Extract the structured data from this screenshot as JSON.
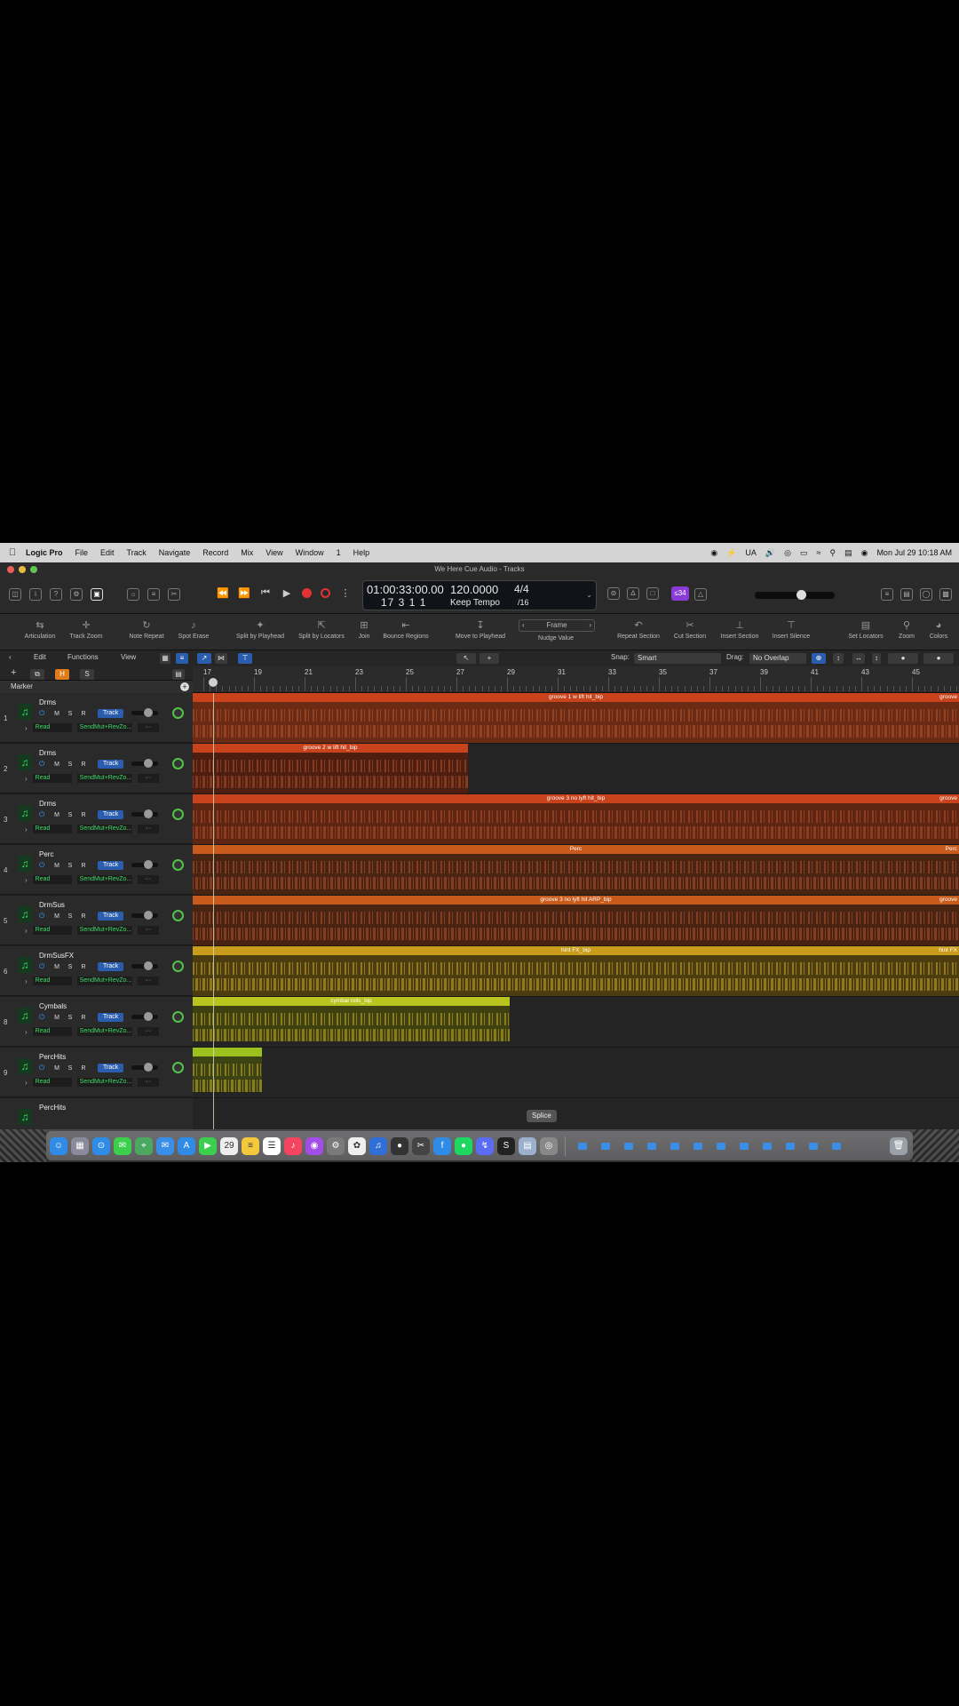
{
  "menubar": {
    "app": "Logic Pro",
    "items": [
      "File",
      "Edit",
      "Track",
      "Navigate",
      "Record",
      "Mix",
      "View",
      "Window",
      "1",
      "Help"
    ],
    "status_icons": [
      "record-status-icon",
      "bolt-icon",
      "UA",
      "volume-icon",
      "focus-icon",
      "battery-icon",
      "wifi-icon",
      "search-icon",
      "control-center-icon",
      "siri-icon"
    ],
    "ua_label": "UA",
    "clock": "Mon Jul 29  10:18 AM"
  },
  "window": {
    "title": "We Here Cue Audio - Tracks"
  },
  "control_bar": {
    "position_time": "01:00:33:00.00",
    "position_bars": "17  3  1     1",
    "tempo": "120.0000",
    "tempo_mode": "Keep Tempo",
    "time_signature": "4/4",
    "division": "/16",
    "cpu_badge": "≤34",
    "master_volume": 0.6
  },
  "toolbar": {
    "tools": [
      {
        "label": "Articulation",
        "icon": "articulation-icon"
      },
      {
        "label": "Track Zoom",
        "icon": "track-zoom-icon"
      },
      {
        "label": "Note Repeat",
        "icon": "note-repeat-icon"
      },
      {
        "label": "Spot Erase",
        "icon": "spot-erase-icon"
      },
      {
        "label": "Split by Playhead",
        "icon": "split-playhead-icon"
      },
      {
        "label": "Split by Locators",
        "icon": "split-locators-icon"
      },
      {
        "label": "Join",
        "icon": "join-icon"
      },
      {
        "label": "Bounce Regions",
        "icon": "bounce-icon"
      },
      {
        "label": "Move to Playhead",
        "icon": "move-playhead-icon"
      },
      {
        "label": "Nudge Value",
        "icon": "nudge-icon"
      },
      {
        "label": "Repeat Section",
        "icon": "repeat-section-icon"
      },
      {
        "label": "Cut Section",
        "icon": "cut-section-icon"
      },
      {
        "label": "Insert Section",
        "icon": "insert-section-icon"
      },
      {
        "label": "Insert Silence",
        "icon": "insert-silence-icon"
      },
      {
        "label": "Set Locators",
        "icon": "set-locators-icon"
      },
      {
        "label": "Zoom",
        "icon": "zoom-icon"
      },
      {
        "label": "Colors",
        "icon": "colors-icon"
      }
    ],
    "nudge_value": "Frame"
  },
  "tracks_header": {
    "edit": "Edit",
    "functions": "Functions",
    "view": "View",
    "snap_label": "Snap:",
    "snap_value": "Smart",
    "drag_label": "Drag:",
    "drag_value": "No Overlap",
    "h_button": "H",
    "s_button": "S"
  },
  "marker_label": "Marker",
  "ruler": [
    "17",
    "19",
    "21",
    "23",
    "25",
    "27",
    "29",
    "31",
    "33",
    "35",
    "37",
    "39",
    "41",
    "43",
    "45"
  ],
  "tracks": [
    {
      "num": "1",
      "name": "Drms",
      "btn_m": "M",
      "btn_s": "S",
      "btn_r": "R",
      "track_label": "Track",
      "read": "Read",
      "send": "SendMut+RevZo...",
      "dots": "···"
    },
    {
      "num": "2",
      "name": "Drms",
      "btn_m": "M",
      "btn_s": "S",
      "btn_r": "R",
      "track_label": "Track",
      "read": "Read",
      "send": "SendMut+RevZo...",
      "dots": "···"
    },
    {
      "num": "3",
      "name": "Drms",
      "btn_m": "M",
      "btn_s": "S",
      "btn_r": "R",
      "track_label": "Track",
      "read": "Read",
      "send": "SendMut+RevZo...",
      "dots": "···"
    },
    {
      "num": "4",
      "name": "Perc",
      "btn_m": "M",
      "btn_s": "S",
      "btn_r": "R",
      "track_label": "Track",
      "read": "Read",
      "send": "SendMut+RevZo...",
      "dots": "···"
    },
    {
      "num": "5",
      "name": "DrmSus",
      "btn_m": "M",
      "btn_s": "S",
      "btn_r": "R",
      "track_label": "Track",
      "read": "Read",
      "send": "SendMut+RevZo...",
      "dots": "···"
    },
    {
      "num": "6",
      "name": "DrmSusFX",
      "btn_m": "M",
      "btn_s": "S",
      "btn_r": "R",
      "track_label": "Track",
      "read": "Read",
      "send": "SendMut+RevZo...",
      "dots": "···"
    },
    {
      "num": "8",
      "name": "Cymbals",
      "btn_m": "M",
      "btn_s": "S",
      "btn_r": "R",
      "track_label": "Track",
      "read": "Read",
      "send": "SendMut+RevZo...",
      "dots": "···"
    },
    {
      "num": "9",
      "name": "PercHits",
      "btn_m": "M",
      "btn_s": "S",
      "btn_r": "R",
      "track_label": "Track",
      "read": "Read",
      "send": "SendMut+RevZo...",
      "dots": "···"
    },
    {
      "num": "",
      "name": "PercHits",
      "btn_m": "",
      "btn_s": "",
      "btn_r": "",
      "track_label": "",
      "read": "",
      "send": "",
      "dots": ""
    }
  ],
  "regions": [
    {
      "title": "groove 1 w lift hit_bip",
      "tail_label": "groove",
      "color": "#c8431c",
      "body": "#6a2a14"
    },
    {
      "title": "groove 2 w lift hit_bip",
      "tail_label": "",
      "color": "#c8431c",
      "body": "#4e1e10"
    },
    {
      "title": "groove 3 no lyft hit_bip",
      "tail_label": "groove",
      "color": "#c8431c",
      "body": "#5e2512"
    },
    {
      "title": "Perc",
      "tail_label": "Perc",
      "color": "#c85a1c",
      "body": "#4a2412"
    },
    {
      "title": "groove 3 no lyft hit ARP_bip",
      "tail_label": "groove",
      "color": "#c85a1c",
      "body": "#4a2412"
    },
    {
      "title": "hint FX_bip",
      "tail_label": "hint FX",
      "color": "#c99c1c",
      "body": "#4c3c10"
    },
    {
      "title": "cymbal rolls_bip",
      "tail_label": "",
      "color": "#b9c51e",
      "body": "#3f4210"
    },
    {
      "title": "",
      "tail_label": "",
      "color": "#9cc01e",
      "body": "#3d4414"
    }
  ],
  "dock": {
    "tooltip": "Splice",
    "apps": [
      {
        "icon": "finder-icon",
        "glyph": "☺",
        "color": "#2f8be6"
      },
      {
        "icon": "launchpad-icon",
        "glyph": "▦",
        "color": "#8a8a9a"
      },
      {
        "icon": "safari-icon",
        "glyph": "⊙",
        "color": "#2f8be6"
      },
      {
        "icon": "messages-icon",
        "glyph": "✉",
        "color": "#3ccf4e"
      },
      {
        "icon": "maps-icon",
        "glyph": "⌖",
        "color": "#4aa860"
      },
      {
        "icon": "mail-icon",
        "glyph": "✉",
        "color": "#3b8ee8"
      },
      {
        "icon": "app-store-icon",
        "glyph": "A",
        "color": "#2f8be6"
      },
      {
        "icon": "facetime-icon",
        "glyph": "▶",
        "color": "#3ccf4e"
      },
      {
        "icon": "calendar-icon",
        "glyph": "29",
        "color": "#eeeeee"
      },
      {
        "icon": "notes-icon",
        "glyph": "≡",
        "color": "#f3c93b"
      },
      {
        "icon": "reminders-icon",
        "glyph": "☰",
        "color": "#ffffff"
      },
      {
        "icon": "music-icon",
        "glyph": "♪",
        "color": "#f3455f"
      },
      {
        "icon": "podcasts-icon",
        "glyph": "◉",
        "color": "#a24ee6"
      },
      {
        "icon": "system-settings-icon",
        "glyph": "⚙",
        "color": "#7a7a7a"
      },
      {
        "icon": "photos-icon",
        "glyph": "✿",
        "color": "#eeeeee"
      },
      {
        "icon": "instruments-icon",
        "glyph": "♫",
        "color": "#2f6fd6"
      },
      {
        "icon": "logic-pro-icon",
        "glyph": "●",
        "color": "#333333"
      },
      {
        "icon": "final-cut-icon",
        "glyph": "✂",
        "color": "#444444"
      },
      {
        "icon": "affinity-icon",
        "glyph": "f",
        "color": "#2f8be6"
      },
      {
        "icon": "spotify-icon",
        "glyph": "●",
        "color": "#1ed760"
      },
      {
        "icon": "messenger-icon",
        "glyph": "↯",
        "color": "#5b6cf3"
      },
      {
        "icon": "splice-icon",
        "glyph": "S",
        "color": "#222222"
      },
      {
        "icon": "preview-icon",
        "glyph": "▤",
        "color": "#9ab0cc"
      },
      {
        "icon": "disk-utility-icon",
        "glyph": "◎",
        "color": "#888888"
      }
    ],
    "mini_windows": 12,
    "trash": "trash-icon"
  }
}
